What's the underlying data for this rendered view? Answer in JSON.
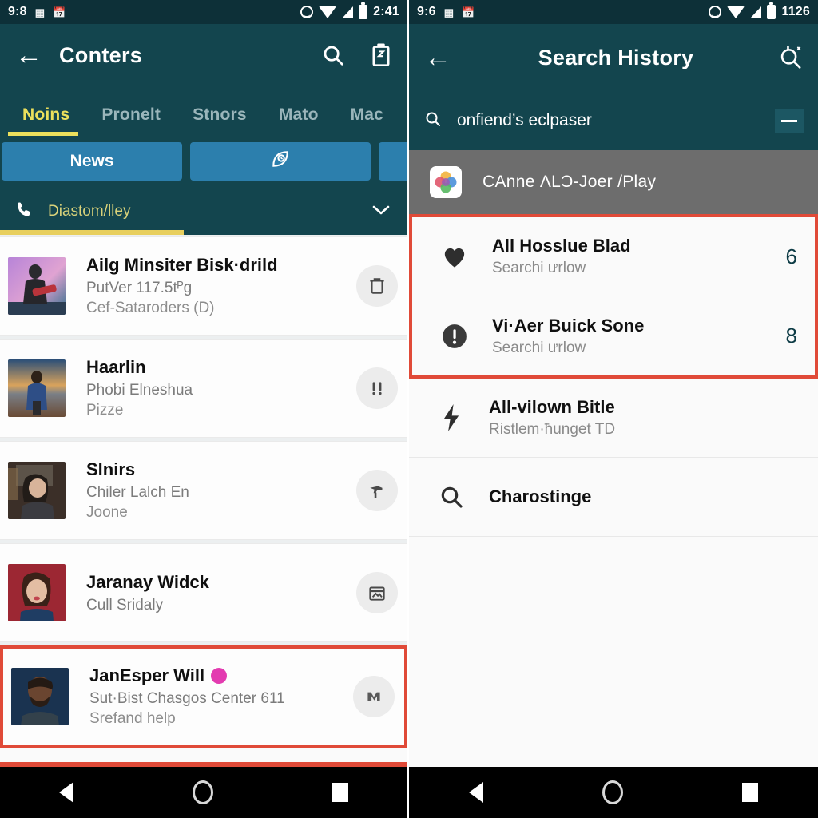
{
  "left": {
    "status_bar": {
      "time_left": "9:8",
      "glyph_1": "qr-code-icon",
      "glyph_2": "calendar-icon",
      "smiley": "smiley-icon",
      "wifi": "wifi-icon",
      "signal": "signal-icon",
      "battery": "battery-icon",
      "clock": "2:41"
    },
    "appbar": {
      "back": "back-arrow-icon",
      "title": "Conters",
      "search": "search-icon",
      "clipboard": "clipboard-icon"
    },
    "tabs": [
      {
        "label": "Noins",
        "active": true
      },
      {
        "label": "Pronelt",
        "active": false
      },
      {
        "label": "Stnors",
        "active": false
      },
      {
        "label": "Mato",
        "active": false
      },
      {
        "label": "Mac",
        "active": false
      }
    ],
    "chips": [
      {
        "label": "News",
        "icon": ""
      },
      {
        "label": "",
        "icon": "leaf-clock-icon"
      },
      {
        "label": "",
        "icon": ""
      }
    ],
    "filter": {
      "icon": "phone-icon",
      "label": "Diastom/lley",
      "chevron": "chevron-down-icon"
    },
    "cards": [
      {
        "title": "Ailg Minsiter Bisk·drild",
        "sub1": "PutVer 117.5tᴾɡ",
        "sub2": "Cef-Sataroders (D)",
        "trailing_icon": "trash-icon",
        "badge": false,
        "highlight": false
      },
      {
        "title": "Haarlin",
        "sub1": "Phobi Elneshua",
        "sub2": "Pizze",
        "trailing_icon": "double-exclamation-icon",
        "badge": false,
        "highlight": false
      },
      {
        "title": "Slnirs",
        "sub1": "Chiler Lalch En",
        "sub2": "Joone",
        "trailing_icon": "tool-icon",
        "badge": false,
        "highlight": false
      },
      {
        "title": "Jaranay Widck",
        "sub1": "Cull Sridaly",
        "sub2": "",
        "trailing_icon": "calendar-image-icon",
        "badge": false,
        "highlight": false
      },
      {
        "title": "JanEsper Will",
        "sub1": "Sut·Bist Chasgos Center 611",
        "sub2": "Srefand help",
        "trailing_icon": "medium-m-icon",
        "badge": true,
        "highlight": true
      }
    ],
    "navbar": {
      "back": "nav-back-icon",
      "home": "nav-home-icon",
      "recent": "nav-recent-icon"
    }
  },
  "right": {
    "status_bar": {
      "time_left": "9:6",
      "glyph_1": "qr-code-icon",
      "glyph_2": "calendar-icon",
      "smiley": "smiley-icon",
      "wifi": "wifi-icon",
      "signal": "signal-icon",
      "battery": "battery-icon",
      "clock": "1126"
    },
    "appbar": {
      "back": "back-arrow-icon",
      "title": "Search History",
      "search": "search-settings-icon"
    },
    "search": {
      "icon": "search-icon",
      "query": "onfiend’s eclpaser",
      "collapse": "minus-icon"
    },
    "banner": {
      "icon": "photos-app-icon",
      "label": "CAnne ΛLƆ-Joer /Play"
    },
    "history": [
      {
        "icon": "heart-icon",
        "title": "All Hosslue Blad",
        "sub": "Searchi ưrlow",
        "count": "6",
        "highlight": true
      },
      {
        "icon": "exclamation-circle-icon",
        "title": "Vi·Aer Buick Sone",
        "sub": "Searchi ưrlow",
        "count": "8",
        "highlight": true
      },
      {
        "icon": "lightning-bolt-icon",
        "title": "All-vilown Bitle",
        "sub": "Ristlem·ħunget TD",
        "count": "",
        "highlight": false
      },
      {
        "icon": "search-icon",
        "title": "Charostinge",
        "sub": "",
        "count": "",
        "highlight": false
      }
    ],
    "navbar": {
      "back": "nav-back-icon",
      "home": "nav-home-icon",
      "recent": "nav-recent-icon"
    }
  },
  "colors": {
    "appbar": "#13454e",
    "statusbar": "#0d3038",
    "accent_yellow": "#ebe05c",
    "chip_blue": "#2c7fad",
    "highlight_red": "#e04a38",
    "count_teal": "#0d3b45",
    "banner_gray": "#6d6d6d",
    "badge_pink": "#e33bb0"
  }
}
